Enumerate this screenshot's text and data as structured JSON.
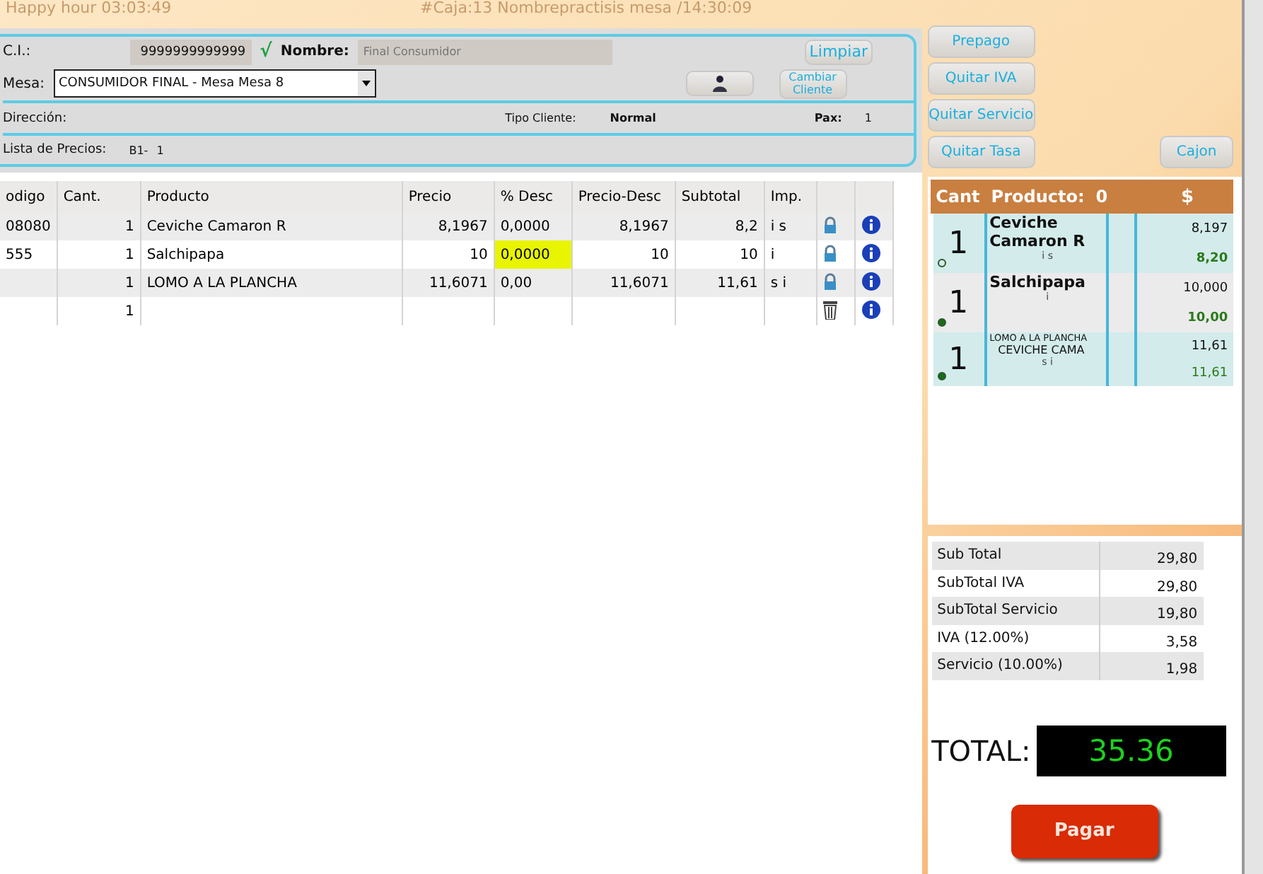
{
  "header": {
    "left": "Happy hour 03:03:49",
    "right": "#Caja:13 Nombrepractisis mesa /14:30:09"
  },
  "client": {
    "ci_label": "C.I.:",
    "ci": "9999999999999",
    "check": "√",
    "name_label": "Nombre:",
    "name_placeholder": "Final Consumidor",
    "mesa_label": "Mesa:",
    "mesa": "CONSUMIDOR FINAL - Mesa Mesa 8",
    "buttons": [
      "Limpiar",
      "Cambiar Cliente"
    ],
    "direccion_label": "Dirección:",
    "tipo_label": "Tipo Cliente:",
    "tipo": "Normal",
    "pax_label": "Pax:",
    "pax": "1",
    "lista_label": "Lista de Precios:",
    "lista_code": "B1-",
    "lista": "1"
  },
  "table": {
    "columns": [
      "odigo",
      "Cant.",
      "Producto",
      "Precio",
      "% Desc",
      "Precio-Desc",
      "Subtotal",
      "Imp."
    ],
    "rows": [
      {
        "cells": [
          "08080",
          "1",
          "Ceviche Camaron R",
          "8,1967",
          "0,0000",
          "8,1967",
          "8,2",
          "i s"
        ],
        "highlighted": false,
        "kind": "item"
      },
      {
        "cells": [
          "555",
          "1",
          "Salchipapa",
          "10",
          "0,0000",
          "10",
          "10",
          "i"
        ],
        "highlighted": true,
        "kind": "item"
      },
      {
        "cells": [
          "",
          "1",
          "LOMO A LA PLANCHA",
          "11,6071",
          "0,00",
          "11,6071",
          "11,61",
          "s i"
        ],
        "highlighted": false,
        "kind": "item"
      },
      {
        "cells": [
          "",
          "1",
          "",
          "",
          "",
          "",
          "",
          ""
        ],
        "highlighted": false,
        "kind": "new"
      }
    ]
  },
  "side_buttons": [
    "Prepago",
    "Quitar IVA",
    "Quitar Servicio",
    "Quitar Tasa"
  ],
  "drawer_button": "Cajon",
  "ticket": {
    "header": [
      "Cant",
      "Producto:",
      "0",
      "$"
    ],
    "items": [
      {
        "qty": "1",
        "lines": [
          "Ceviche Camaron R"
        ],
        "flags": "i s",
        "price": "8,197",
        "total": "8,20",
        "marked": false,
        "kind": "big"
      },
      {
        "qty": "1",
        "lines": [
          "Salchipapa"
        ],
        "flags": "i",
        "price": "10,000",
        "total": "10,00",
        "marked": true,
        "kind": "big"
      },
      {
        "qty": "1",
        "lines": [
          "LOMO A LA PLANCHA",
          "CEVICHE CAMA"
        ],
        "flags": "s i",
        "price": "11,61",
        "total": "11,61",
        "marked": true,
        "kind": "small"
      }
    ]
  },
  "summary": [
    {
      "label": "Sub Total",
      "value": "29,80"
    },
    {
      "label": "SubTotal IVA",
      "value": "29,80"
    },
    {
      "label": "SubTotal Servicio",
      "value": "19,80"
    },
    {
      "label": "IVA (12.00%)",
      "value": "3,58"
    },
    {
      "label": "Servicio (10.00%)",
      "value": "1,98"
    }
  ],
  "total": {
    "label": "TOTAL:",
    "value": "35.36"
  },
  "pay_button": "Pagar"
}
